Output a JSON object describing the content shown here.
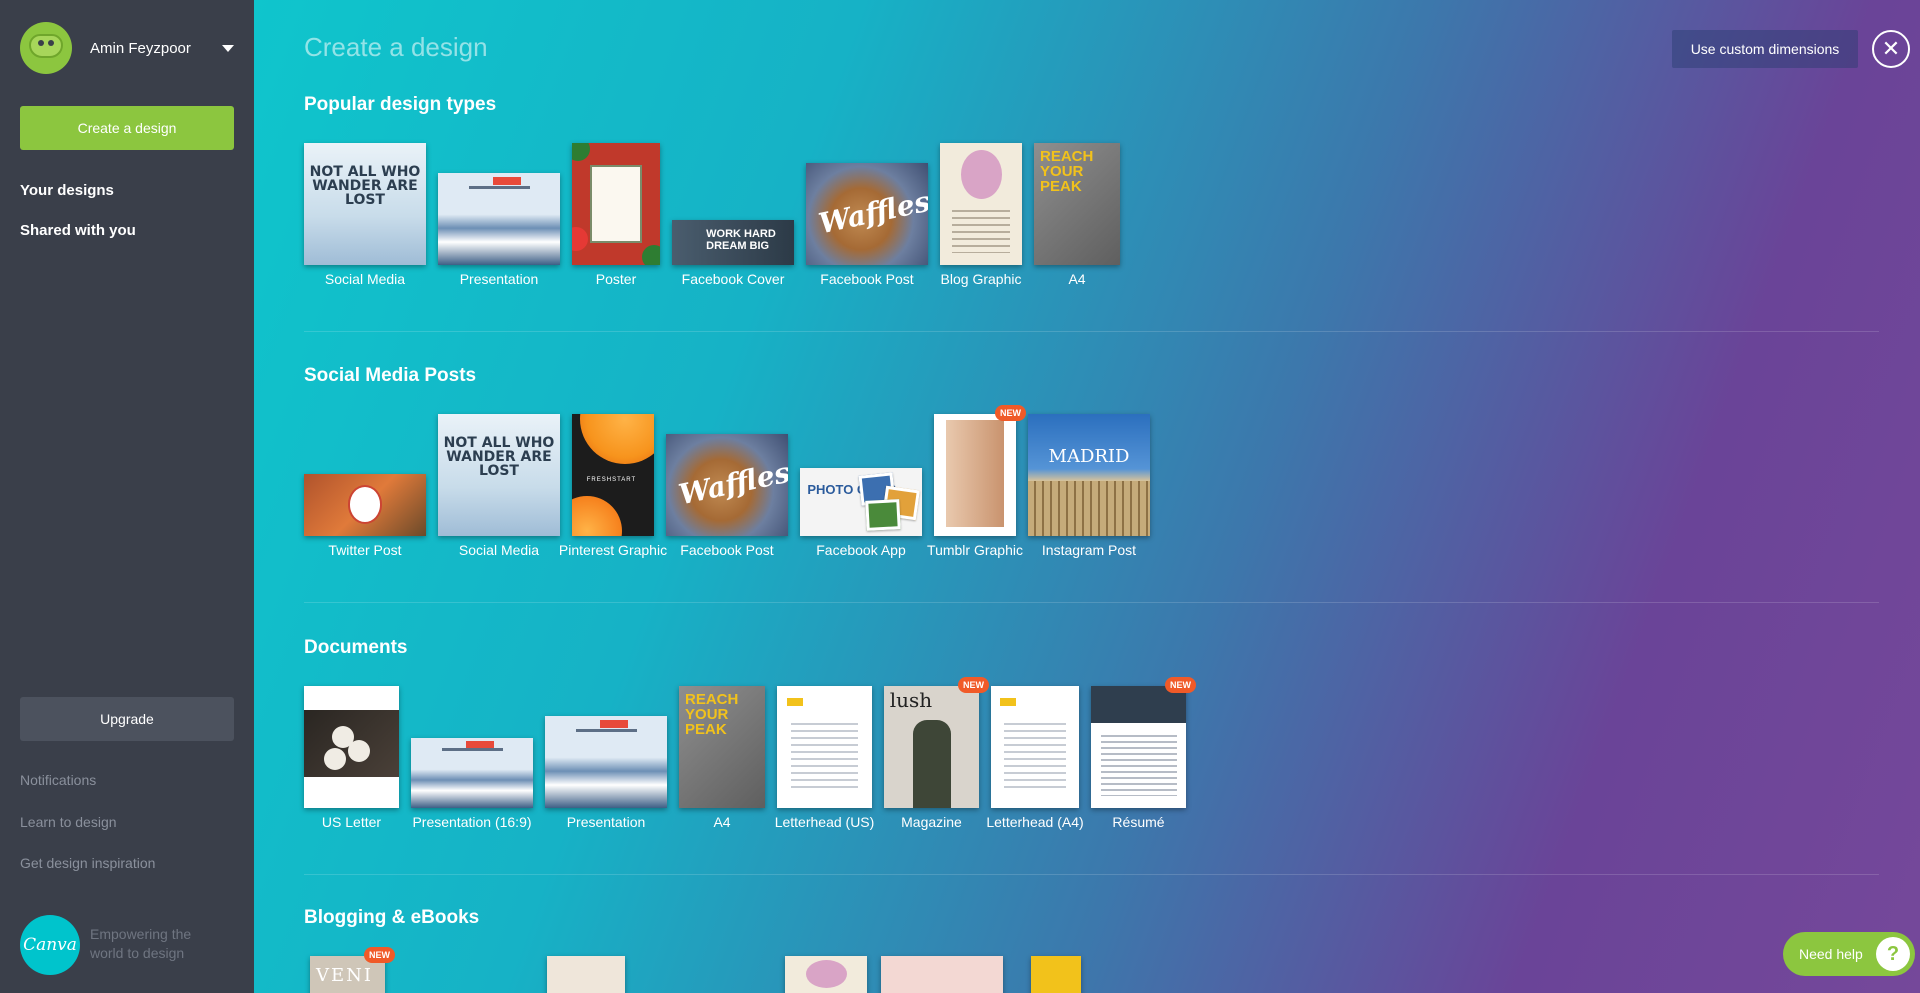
{
  "user": {
    "name": "Amin Feyzpoor"
  },
  "sidebar": {
    "create_button": "Create a design",
    "primary_links": [
      "Your designs",
      "Shared with you"
    ],
    "upgrade_button": "Upgrade",
    "secondary_links": [
      "Notifications",
      "Learn to design",
      "Get design inspiration"
    ],
    "logo_text": "Canva",
    "tagline": "Empowering the world to design"
  },
  "header": {
    "title": "Create a design",
    "custom_dimensions_button": "Use custom dimensions",
    "close_icon": "close-icon"
  },
  "sections": [
    {
      "title": "Popular design types",
      "items": [
        {
          "label": "Social Media",
          "new": false
        },
        {
          "label": "Presentation",
          "new": false
        },
        {
          "label": "Poster",
          "new": false
        },
        {
          "label": "Facebook Cover",
          "new": false
        },
        {
          "label": "Facebook Post",
          "new": false
        },
        {
          "label": "Blog Graphic",
          "new": false
        },
        {
          "label": "A4",
          "new": false
        }
      ]
    },
    {
      "title": "Social Media Posts",
      "items": [
        {
          "label": "Twitter Post",
          "new": false
        },
        {
          "label": "Social Media",
          "new": false
        },
        {
          "label": "Pinterest Graphic",
          "new": false
        },
        {
          "label": "Facebook Post",
          "new": false
        },
        {
          "label": "Facebook App",
          "new": false
        },
        {
          "label": "Tumblr Graphic",
          "new": true
        },
        {
          "label": "Instagram Post",
          "new": false
        }
      ]
    },
    {
      "title": "Documents",
      "items": [
        {
          "label": "US Letter",
          "new": false
        },
        {
          "label": "Presentation (16:9)",
          "new": false
        },
        {
          "label": "Presentation",
          "new": false
        },
        {
          "label": "A4",
          "new": false
        },
        {
          "label": "Letterhead (US)",
          "new": false
        },
        {
          "label": "Magazine",
          "new": true
        },
        {
          "label": "Letterhead (A4)",
          "new": false
        },
        {
          "label": "Résumé",
          "new": true
        }
      ]
    },
    {
      "title": "Blogging & eBooks",
      "items": [
        {
          "label": "",
          "new": true
        },
        {
          "label": "",
          "new": false
        },
        {
          "label": "",
          "new": false
        },
        {
          "label": "",
          "new": false
        },
        {
          "label": "",
          "new": false
        }
      ]
    }
  ],
  "thumb_text": {
    "wander": "NOT ALL WHO WANDER ARE LOST",
    "work_hard": "WORK HARD DREAM BIG",
    "waffles": "Waffles",
    "reach": "REACH YOUR PEAK",
    "photo_comp": "PHOTO COMP",
    "madrid": "MADRID",
    "lush": "lush",
    "veni": "VENI",
    "new_badge": "NEW"
  },
  "help": {
    "label": "Need help",
    "icon": "question-icon"
  },
  "colors": {
    "sidebar_bg": "#3a3f4a",
    "accent_green": "#8cc63f",
    "new_badge": "#f05a28",
    "gradient_start": "#0fc5cc",
    "gradient_end": "#75489a"
  }
}
